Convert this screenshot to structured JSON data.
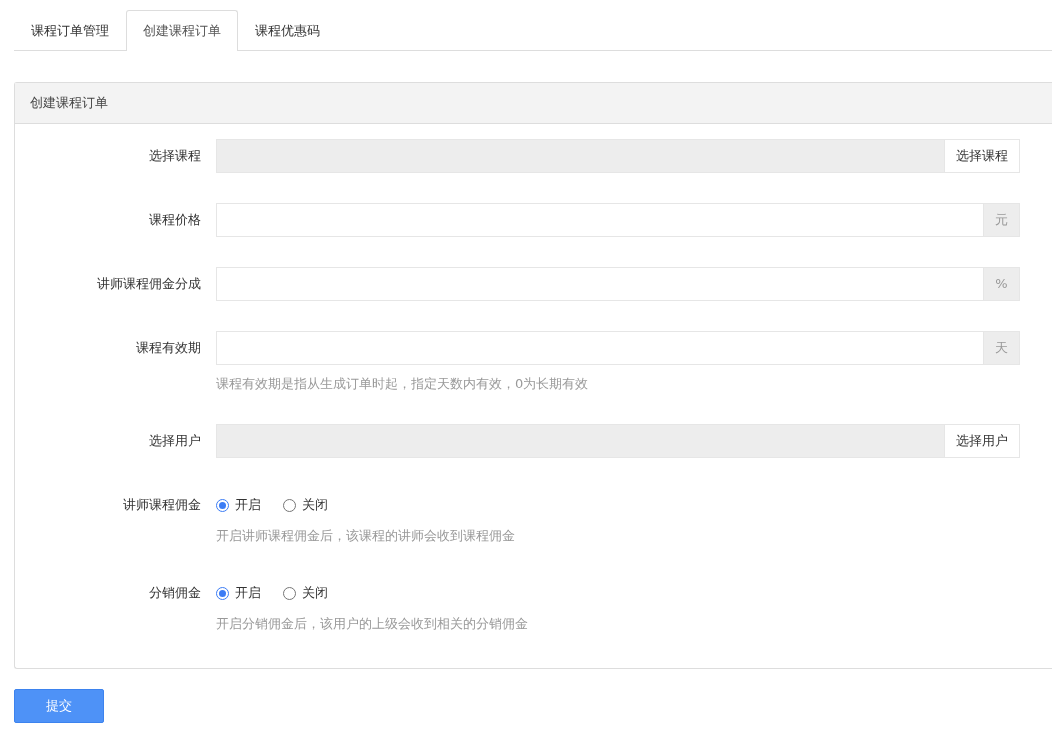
{
  "tabs": [
    {
      "label": "课程订单管理",
      "selected": false
    },
    {
      "label": "创建课程订单",
      "selected": true
    },
    {
      "label": "课程优惠码",
      "selected": false
    }
  ],
  "panel": {
    "title": "创建课程订单",
    "fields": [
      {
        "kind": "select",
        "label": "选择课程",
        "button": "选择课程"
      },
      {
        "kind": "addon",
        "label": "课程价格",
        "addon": "元"
      },
      {
        "kind": "addon",
        "label": "讲师课程佣金分成",
        "addon": "%"
      },
      {
        "kind": "addon",
        "label": "课程有效期",
        "addon": "天",
        "hint": "课程有效期是指从生成订单时起，指定天数内有效，0为长期有效"
      },
      {
        "kind": "select",
        "label": "选择用户",
        "button": "选择用户"
      },
      {
        "kind": "radio",
        "label": "讲师课程佣金",
        "options": [
          {
            "label": "开启",
            "selected": true
          },
          {
            "label": "关闭",
            "selected": false
          }
        ],
        "hint": "开启讲师课程佣金后，该课程的讲师会收到课程佣金"
      },
      {
        "kind": "radio",
        "label": "分销佣金",
        "options": [
          {
            "label": "开启",
            "selected": true
          },
          {
            "label": "关闭",
            "selected": false
          }
        ],
        "hint": "开启分销佣金后，该用户的上级会收到相关的分销佣金"
      }
    ]
  },
  "submit": "提交"
}
